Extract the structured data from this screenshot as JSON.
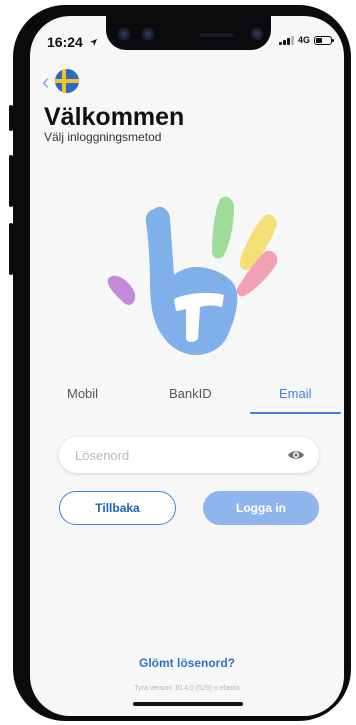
{
  "status_bar": {
    "time": "16:24",
    "network": "4G"
  },
  "header": {
    "title": "Välkommen",
    "subtitle": "Välj inloggningsmetod"
  },
  "tabs": [
    {
      "label": "Mobil",
      "active": false
    },
    {
      "label": "BankID",
      "active": false
    },
    {
      "label": "Email",
      "active": true
    }
  ],
  "password_field": {
    "placeholder": "Lösenord",
    "value": ""
  },
  "buttons": {
    "back_label": "Tillbaka",
    "login_label": "Logga in"
  },
  "forgot_password_label": "Glömt lösenord?",
  "version_text": "Tyra version 10.4.0 (529) o elastix",
  "colors": {
    "accent": "#3e83d8",
    "login_button": "#8fb5ee",
    "background": "#f7f7f8"
  },
  "icons": {
    "back": "chevron-left-icon",
    "language": "swedish-flag-icon",
    "password_visibility": "eye-icon",
    "logo": "tyra-hand-logo"
  }
}
